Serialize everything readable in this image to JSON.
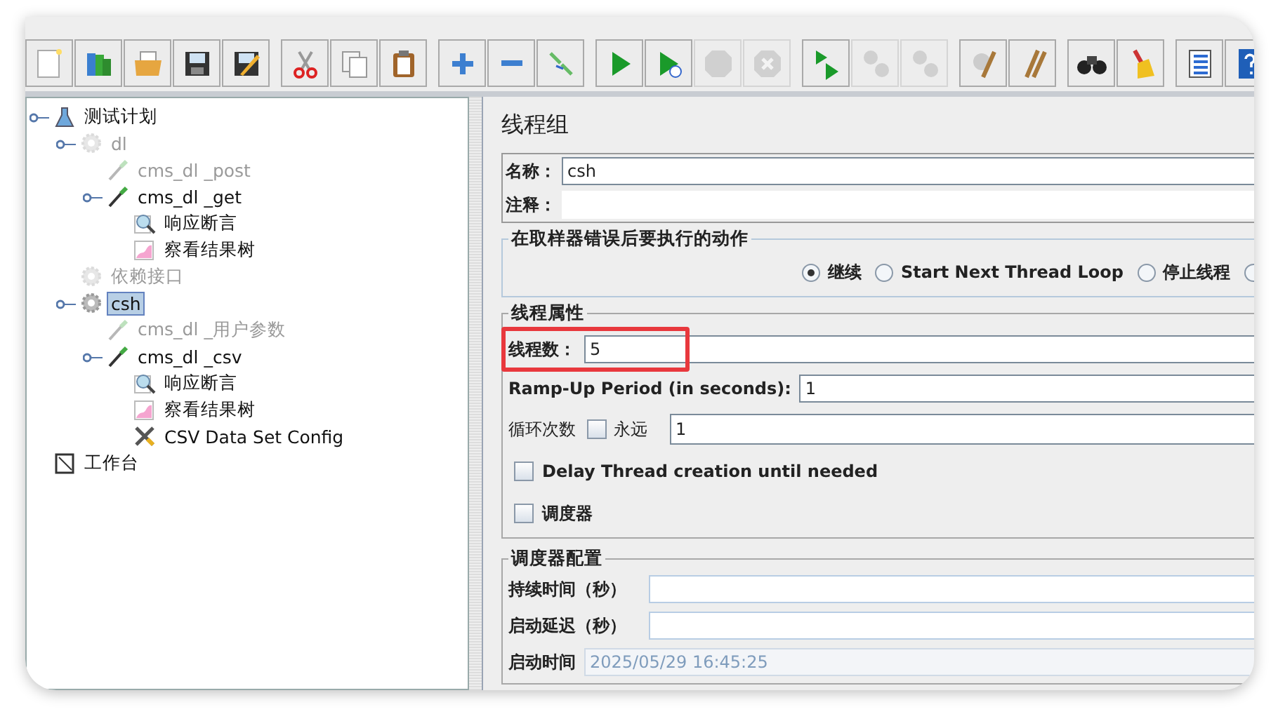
{
  "toolbar": [
    {
      "buttons": [
        {
          "kind": "new",
          "disabled": false
        },
        {
          "kind": "templates",
          "disabled": false
        },
        {
          "kind": "open",
          "disabled": false
        },
        {
          "kind": "save",
          "disabled": false
        },
        {
          "kind": "save-as",
          "disabled": false
        }
      ]
    },
    {
      "buttons": [
        {
          "kind": "cut",
          "disabled": false
        },
        {
          "kind": "copy",
          "disabled": false
        },
        {
          "kind": "paste",
          "disabled": false
        }
      ]
    },
    {
      "buttons": [
        {
          "kind": "expand",
          "disabled": false
        },
        {
          "kind": "collapse",
          "disabled": false
        },
        {
          "kind": "toggle",
          "disabled": false
        }
      ]
    },
    {
      "buttons": [
        {
          "kind": "start",
          "disabled": false
        },
        {
          "kind": "start-no-timers",
          "disabled": false
        },
        {
          "kind": "stop",
          "disabled": true
        },
        {
          "kind": "shutdown",
          "disabled": true
        }
      ]
    },
    {
      "buttons": [
        {
          "kind": "remote-start",
          "disabled": false
        },
        {
          "kind": "remote-stop",
          "disabled": true
        },
        {
          "kind": "remote-exit",
          "disabled": true
        }
      ]
    },
    {
      "buttons": [
        {
          "kind": "clear",
          "disabled": false
        },
        {
          "kind": "clear-all",
          "disabled": false
        }
      ]
    },
    {
      "buttons": [
        {
          "kind": "search",
          "disabled": false
        },
        {
          "kind": "reset",
          "disabled": false
        }
      ]
    },
    {
      "buttons": [
        {
          "kind": "functions",
          "disabled": false
        },
        {
          "kind": "help",
          "disabled": false
        }
      ]
    }
  ],
  "tree": [
    {
      "label": "测试计划",
      "kind": "plan",
      "disabled": false,
      "selected": false,
      "children": [
        {
          "label": "dl",
          "kind": "group",
          "disabled": true,
          "selected": false,
          "children": [
            {
              "label": "cms_dl _post",
              "kind": "sampler",
              "disabled": true,
              "selected": false
            },
            {
              "label": "cms_dl _get",
              "kind": "sampler",
              "disabled": false,
              "selected": false,
              "children": [
                {
                  "label": "响应断言",
                  "kind": "assertion",
                  "disabled": false,
                  "selected": false
                },
                {
                  "label": "察看结果树",
                  "kind": "listener",
                  "disabled": false,
                  "selected": false
                }
              ]
            }
          ]
        },
        {
          "label": "依赖接口",
          "kind": "group",
          "disabled": true,
          "selected": false
        },
        {
          "label": "csh",
          "kind": "group",
          "disabled": false,
          "selected": true,
          "children": [
            {
              "label": "cms_dl _用户参数",
              "kind": "sampler",
              "disabled": true,
              "selected": false
            },
            {
              "label": "cms_dl _csv",
              "kind": "sampler",
              "disabled": false,
              "selected": false,
              "children": [
                {
                  "label": "响应断言",
                  "kind": "assertion",
                  "disabled": false,
                  "selected": false
                },
                {
                  "label": "察看结果树",
                  "kind": "listener",
                  "disabled": false,
                  "selected": false
                },
                {
                  "label": "CSV Data Set Config",
                  "kind": "config",
                  "disabled": false,
                  "selected": false
                }
              ]
            }
          ]
        }
      ]
    },
    {
      "label": "工作台",
      "kind": "workbench",
      "disabled": false,
      "selected": false
    }
  ],
  "panel": {
    "title": "线程组",
    "name": {
      "label": "名称：",
      "value": "csh"
    },
    "comment": {
      "label": "注释："
    },
    "error_action": {
      "title": "在取样器错误后要执行的动作",
      "options": [
        {
          "label": "继续",
          "selected": true
        },
        {
          "label": "Start Next Thread Loop",
          "selected": false
        },
        {
          "label": "停止线程",
          "selected": false
        },
        {
          "selected": false
        }
      ]
    },
    "thread_props": {
      "title": "线程属性",
      "threads": {
        "label": "线程数：",
        "value": "5"
      },
      "ramp_up": {
        "label": "Ramp-Up Period (in seconds):",
        "value": "1"
      },
      "loops": {
        "label": "循环次数",
        "forever_label": "永远",
        "forever_checked": false,
        "value": "1"
      },
      "delay": {
        "label": "Delay Thread creation until needed",
        "checked": false
      },
      "scheduler": {
        "label": "调度器",
        "checked": false
      }
    },
    "scheduler_config": {
      "title": "调度器配置",
      "fields": [
        {
          "label": "持续时间（秒）",
          "disabled": false
        },
        {
          "label": "启动延迟（秒）",
          "disabled": false
        },
        {
          "label": "启动时间",
          "value": "2025/05/29 16:45:25",
          "disabled": true
        }
      ]
    }
  }
}
